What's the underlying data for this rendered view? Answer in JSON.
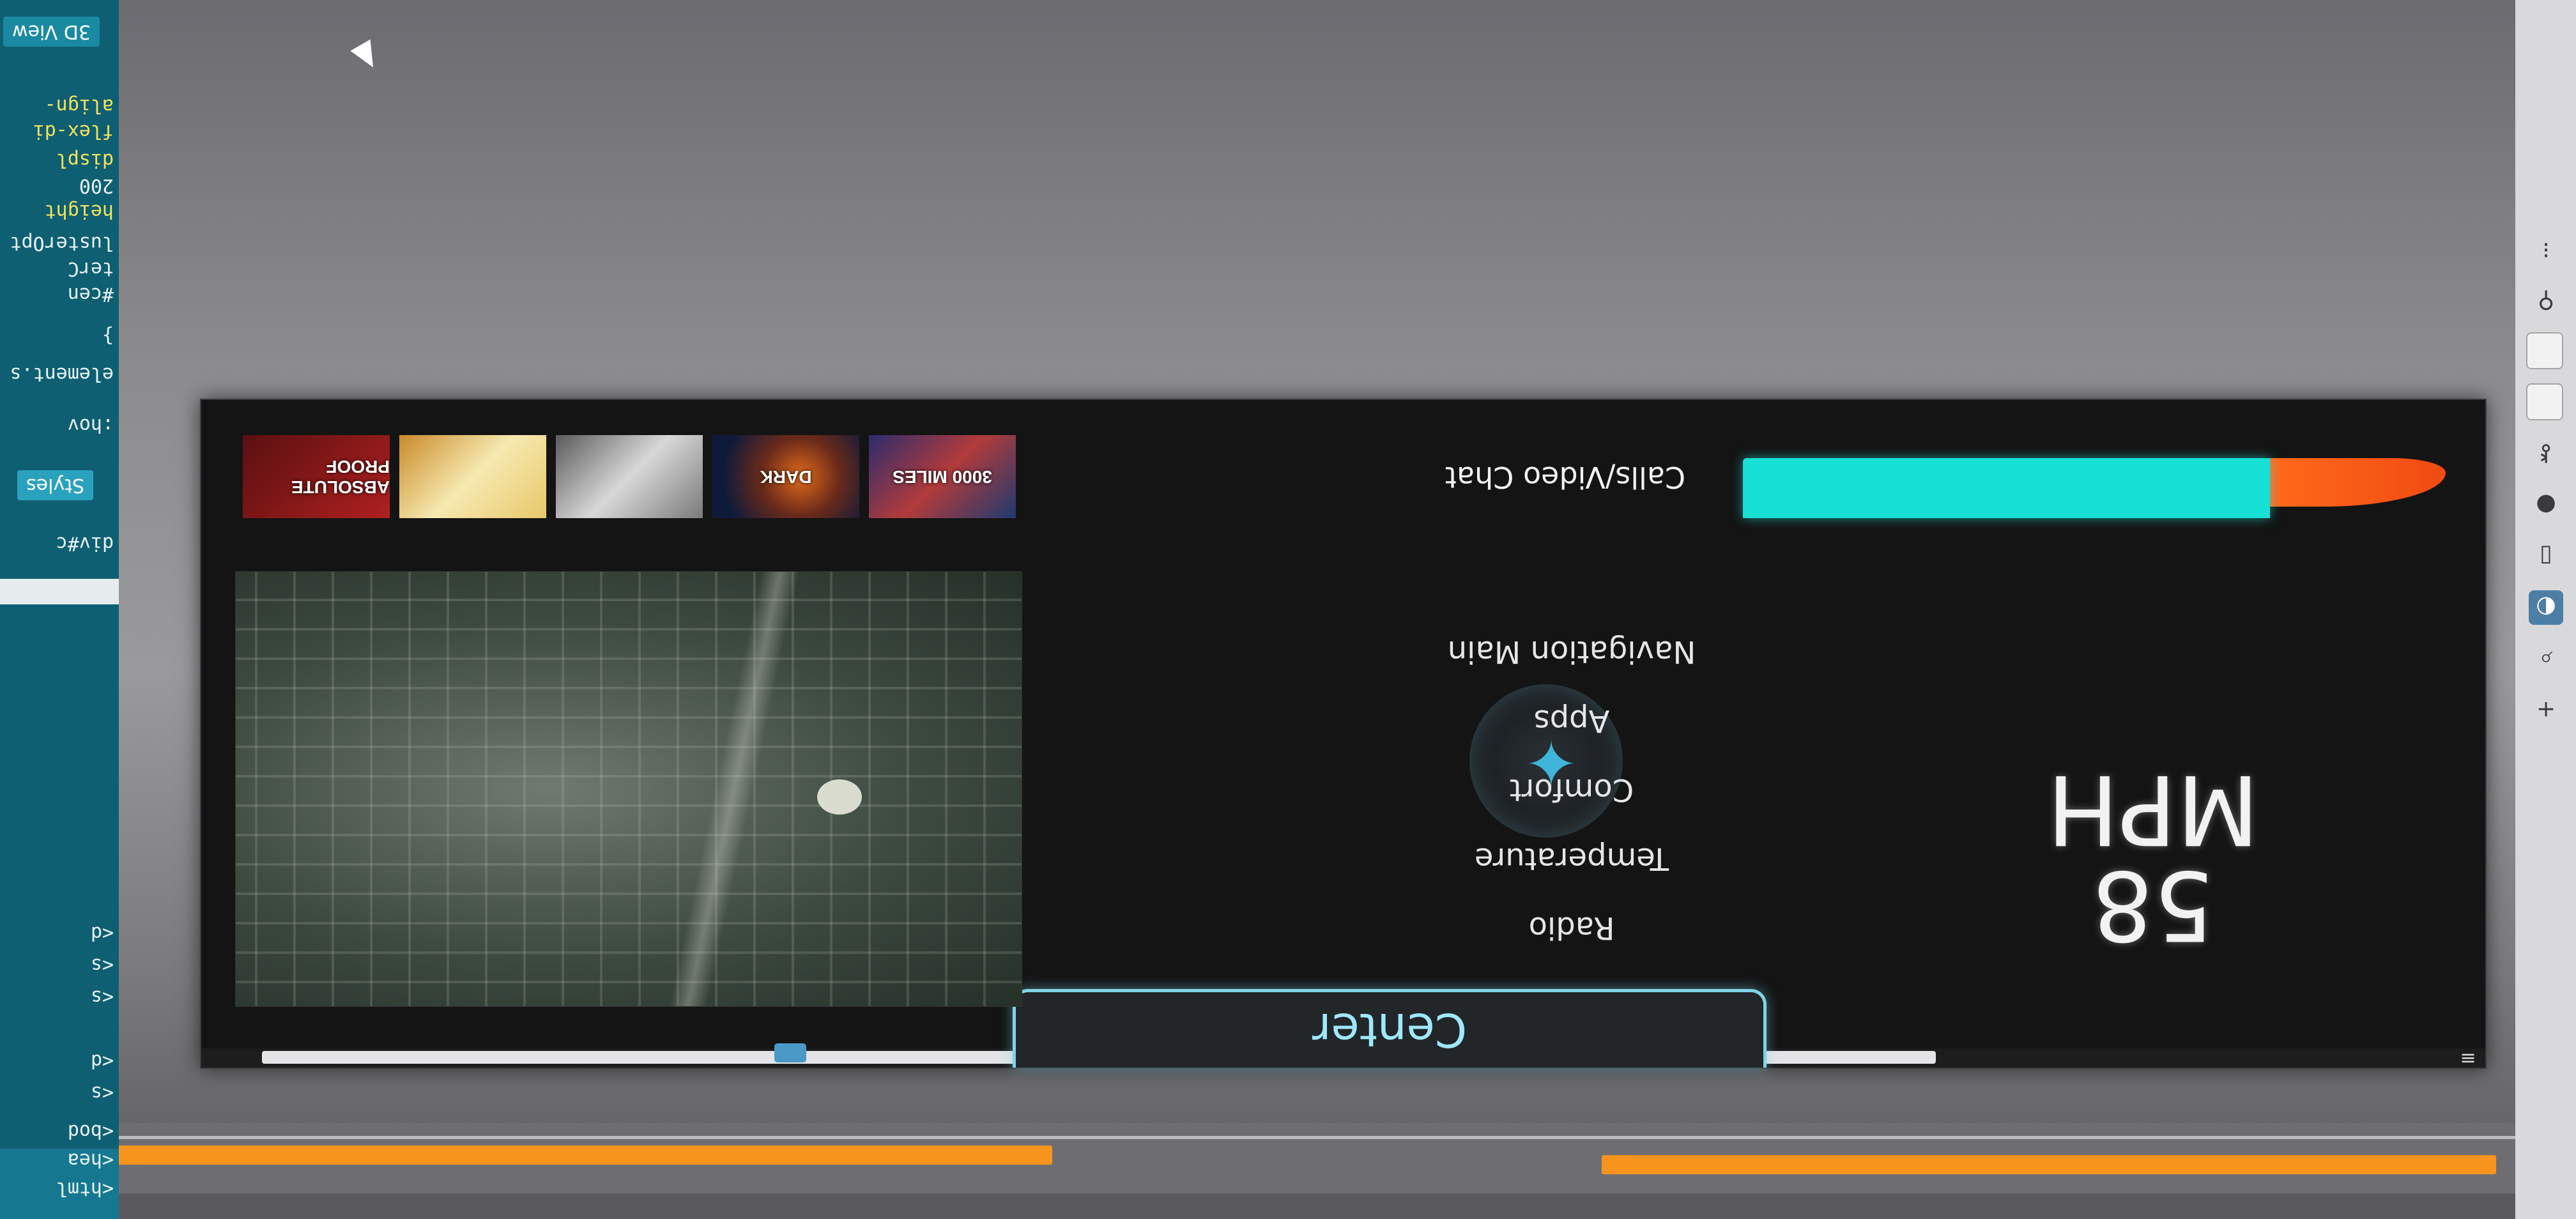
{
  "app": {
    "speed_value": "58",
    "speed_unit": "MPH",
    "center_tab": "Center",
    "menu": [
      "Radio",
      "Temperature",
      "Comfort",
      "Apps",
      "Navigation Main",
      "Calls/Video Chat"
    ],
    "progress_fraction": 0.75,
    "media_cards": [
      {
        "label": "3000 MILES"
      },
      {
        "label": "DARK"
      },
      {
        "label": ""
      },
      {
        "label": ""
      },
      {
        "label": "ABSOLUTE PROOF"
      }
    ],
    "colors": {
      "accent_cyan": "#17e0d4",
      "accent_orange": "#f04a12",
      "tab_border": "#7fd3e6"
    }
  },
  "devtools": {
    "view_button": "3D View",
    "styles_tab": "Styles",
    "hov_filter": ":hov",
    "selected_node": "div#c",
    "css_lines": [
      "element.s",
      "}",
      "#cen",
      "terC",
      "lusterOpt",
      "height",
      "200",
      "displ",
      "flex-di",
      "align-"
    ],
    "dom_lines": [
      "<html",
      "<hea",
      "<bod",
      "<s",
      "<d",
      "<s",
      "<s",
      "<d"
    ]
  },
  "icons": [
    "menu-icon",
    "plus-icon",
    "cursor-icon"
  ]
}
